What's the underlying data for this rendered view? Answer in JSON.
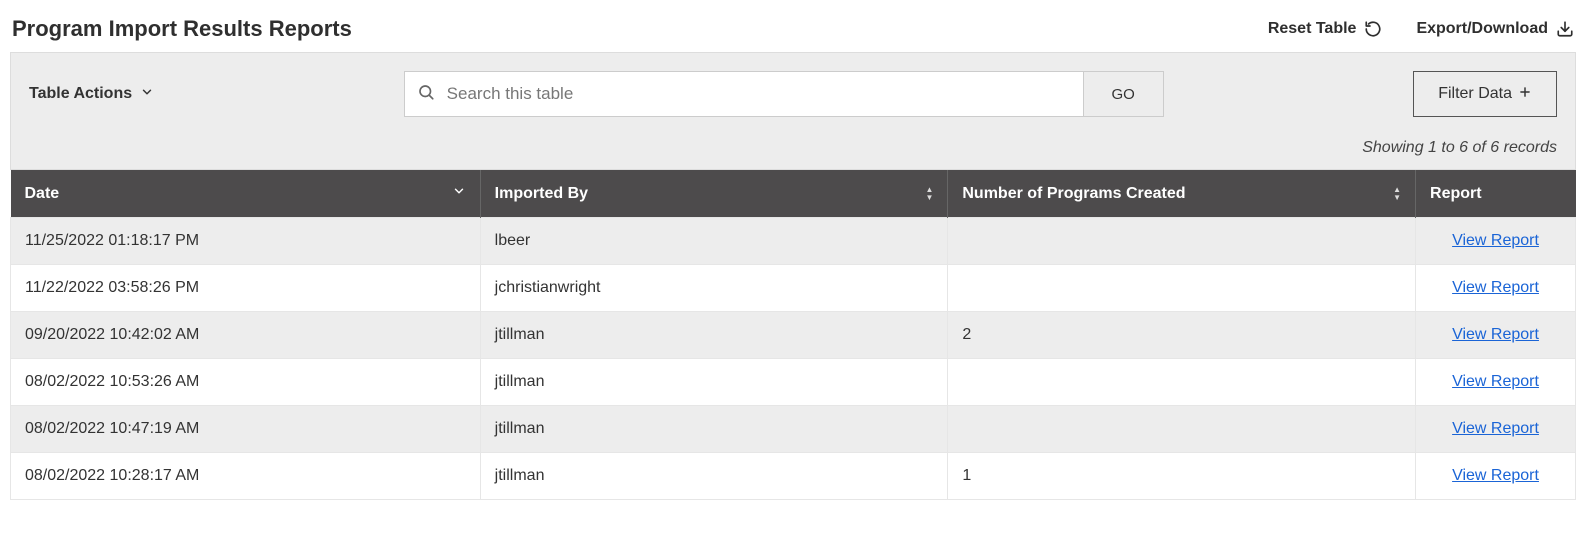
{
  "header": {
    "title": "Program Import Results Reports",
    "reset_label": "Reset Table",
    "export_label": "Export/Download"
  },
  "toolbar": {
    "table_actions_label": "Table Actions",
    "search_placeholder": "Search this table",
    "go_label": "GO",
    "filter_label": "Filter Data",
    "records_info": "Showing 1 to 6 of 6 records"
  },
  "table": {
    "columns": {
      "date": "Date",
      "imported_by": "Imported By",
      "programs_created": "Number of Programs Created",
      "report": "Report"
    },
    "view_report_label": "View Report",
    "rows": [
      {
        "date": "11/25/2022 01:18:17 PM",
        "imported_by": "lbeer",
        "programs_created": ""
      },
      {
        "date": "11/22/2022 03:58:26 PM",
        "imported_by": "jchristianwright",
        "programs_created": ""
      },
      {
        "date": "09/20/2022 10:42:02 AM",
        "imported_by": "jtillman",
        "programs_created": "2"
      },
      {
        "date": "08/02/2022 10:53:26 AM",
        "imported_by": "jtillman",
        "programs_created": ""
      },
      {
        "date": "08/02/2022 10:47:19 AM",
        "imported_by": "jtillman",
        "programs_created": ""
      },
      {
        "date": "08/02/2022 10:28:17 AM",
        "imported_by": "jtillman",
        "programs_created": "1"
      }
    ]
  }
}
